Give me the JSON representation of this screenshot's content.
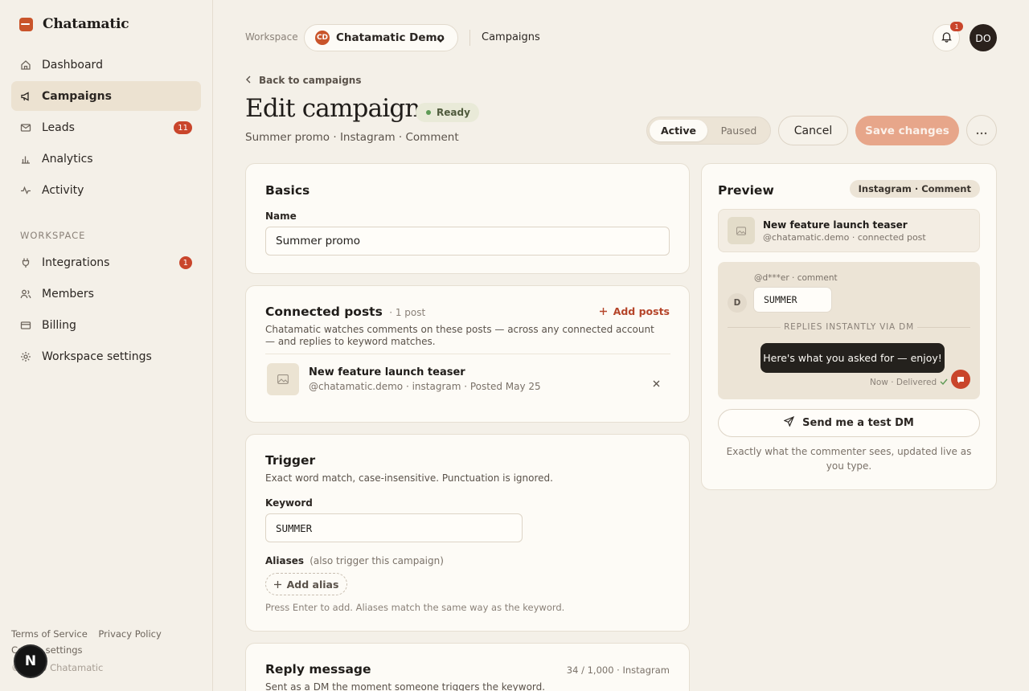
{
  "brand": {
    "name": "Chatamatic"
  },
  "sidebar": {
    "items": [
      {
        "label": "Dashboard",
        "icon": "home-icon"
      },
      {
        "label": "Campaigns",
        "icon": "megaphone-icon",
        "active": true
      },
      {
        "label": "Leads",
        "icon": "mail-icon",
        "badge": "11"
      },
      {
        "label": "Analytics",
        "icon": "bar-chart-icon"
      },
      {
        "label": "Activity",
        "icon": "activity-icon"
      }
    ],
    "section_label": "WORKSPACE",
    "workspace_items": [
      {
        "label": "Integrations",
        "icon": "plug-icon",
        "badge": "1"
      },
      {
        "label": "Members",
        "icon": "users-icon"
      },
      {
        "label": "Billing",
        "icon": "credit-card-icon"
      },
      {
        "label": "Workspace settings",
        "icon": "gear-icon"
      }
    ],
    "footer": {
      "terms": "Terms of Service",
      "privacy": "Privacy Policy",
      "cookie": "Cookie settings",
      "copyright": "© 2025 Chatamatic"
    },
    "fab_letter": "N"
  },
  "topbar": {
    "workspace_label": "Workspace",
    "workspace_initials": "CD",
    "workspace_name": "Chatamatic Demo",
    "crumb": "Campaigns",
    "notification_count": "1",
    "user_initials": "DO"
  },
  "header": {
    "back_label": "Back to campaigns",
    "title": "Edit campaign",
    "status": "Ready",
    "subtitle": "Summer promo · Instagram · Comment",
    "toggle": {
      "active": "Active",
      "paused": "Paused"
    },
    "cancel": "Cancel",
    "save": "Save changes"
  },
  "basics": {
    "title": "Basics",
    "name_label": "Name",
    "name_value": "Summer promo"
  },
  "connected": {
    "title": "Connected posts",
    "count": "· 1 post",
    "add_label": "Add posts",
    "description": "Chatamatic watches comments on these posts — across any connected account — and replies to keyword matches.",
    "post": {
      "title": "New feature launch teaser",
      "meta": "@chatamatic.demo · instagram · Posted May 25"
    }
  },
  "trigger": {
    "title": "Trigger",
    "description": "Exact word match, case-insensitive. Punctuation is ignored.",
    "keyword_label": "Keyword",
    "keyword_value": "SUMMER",
    "aliases_label": "Aliases",
    "aliases_hint": "(also trigger this campaign)",
    "add_alias": "Add alias",
    "footnote": "Press Enter to add. Aliases match the same way as the keyword."
  },
  "reply": {
    "title": "Reply message",
    "counter": "34 / 1,000 · Instagram",
    "description": "Sent as a DM the moment someone triggers the keyword."
  },
  "preview": {
    "title": "Preview",
    "badge": "Instagram · Comment",
    "post_title": "New feature launch teaser",
    "post_meta": "@chatamatic.demo · connected post",
    "commenter_initial": "D",
    "commenter_meta": "@d***er · comment",
    "comment_text": "SUMMER",
    "divider": "REPLIES INSTANTLY VIA DM",
    "reply_text": "Here's what you asked for — enjoy!",
    "reply_status": "Now · Delivered",
    "test_button": "Send me a test DM",
    "hint": "Exactly what the commenter sees, updated live as you type."
  },
  "colors": {
    "accent": "#c9542a",
    "badge": "#c9452b",
    "save_disabled": "#e7a68a",
    "background": "#f4f0e8",
    "card": "#fdfbf6"
  }
}
